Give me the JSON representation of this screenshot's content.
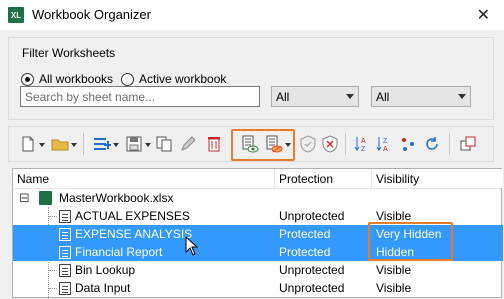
{
  "window": {
    "title": "Workbook Organizer",
    "app_icon_text": "XL",
    "close_glyph": "✕"
  },
  "filter": {
    "group_title": "Filter Worksheets",
    "scope_all_label": "All workbooks",
    "scope_active_label": "Active workbook",
    "selected_scope": "All workbooks",
    "search_placeholder": "Search by sheet name...",
    "search_value": "",
    "protection_filter_value": "All",
    "visibility_filter_value": "All"
  },
  "toolbar": {
    "icons": [
      "new-sheet-icon",
      "open-folder-icon",
      "insert-icon",
      "save-icon",
      "copy-icon",
      "edit-pencil-icon",
      "delete-icon",
      "show-sheet-icon",
      "hide-sheet-icon",
      "protect-shield-icon",
      "unprotect-shield-icon",
      "sort-az-icon",
      "sort-za-icon",
      "shuffle-icon",
      "refresh-icon",
      "duplicate-window-icon"
    ]
  },
  "tree": {
    "columns": {
      "name": "Name",
      "protection": "Protection",
      "visibility": "Visibility"
    },
    "workbook": {
      "expand_glyph": "⊟",
      "name": "MasterWorkbook.xlsx"
    },
    "rows": [
      {
        "name": "ACTUAL EXPENSES",
        "protection": "Unprotected",
        "visibility": "Visible",
        "selected": false
      },
      {
        "name": "EXPENSE ANALYSIS",
        "protection": "Protected",
        "visibility": "Very Hidden",
        "selected": true
      },
      {
        "name": "Financial Report",
        "protection": "Protected",
        "visibility": "Hidden",
        "selected": true
      },
      {
        "name": "Bin Lookup",
        "protection": "Unprotected",
        "visibility": "Visible",
        "selected": false
      },
      {
        "name": "Data Input",
        "protection": "Unprotected",
        "visibility": "Visible",
        "selected": false
      }
    ]
  },
  "colors": {
    "selection": "#3399ff",
    "highlight_box": "#e87b2c",
    "excel_green": "#1e7145"
  }
}
